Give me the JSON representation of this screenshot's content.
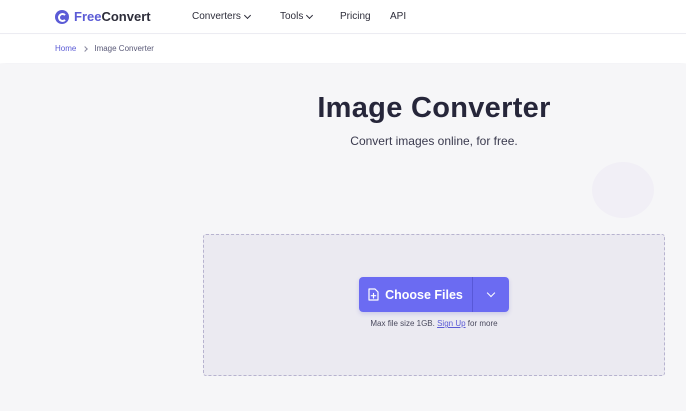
{
  "header": {
    "logo_free": "Free",
    "logo_convert": "Convert",
    "nav": [
      {
        "label": "Converters",
        "has_dropdown": true
      },
      {
        "label": "Tools",
        "has_dropdown": true
      },
      {
        "label": "Pricing",
        "has_dropdown": false
      },
      {
        "label": "API",
        "has_dropdown": false
      }
    ]
  },
  "breadcrumb": {
    "home": "Home",
    "current": "Image Converter"
  },
  "main": {
    "title": "Image Converter",
    "subtitle": "Convert images online, for free.",
    "upload": {
      "button_label": "Choose Files",
      "max_prefix": "Max file size 1GB.",
      "signup_link": "Sign Up",
      "max_suffix": "for more"
    }
  },
  "icons": [
    "logo-icon",
    "chevron-down-icon",
    "chevron-right-icon",
    "file-plus-icon"
  ],
  "colors": {
    "accent": "#6b6bf2",
    "brand": "#5b5bd6",
    "text": "#2d2d3a",
    "page_bg": "#f6f6f8",
    "dropzone_bg": "#ebeaf1"
  }
}
